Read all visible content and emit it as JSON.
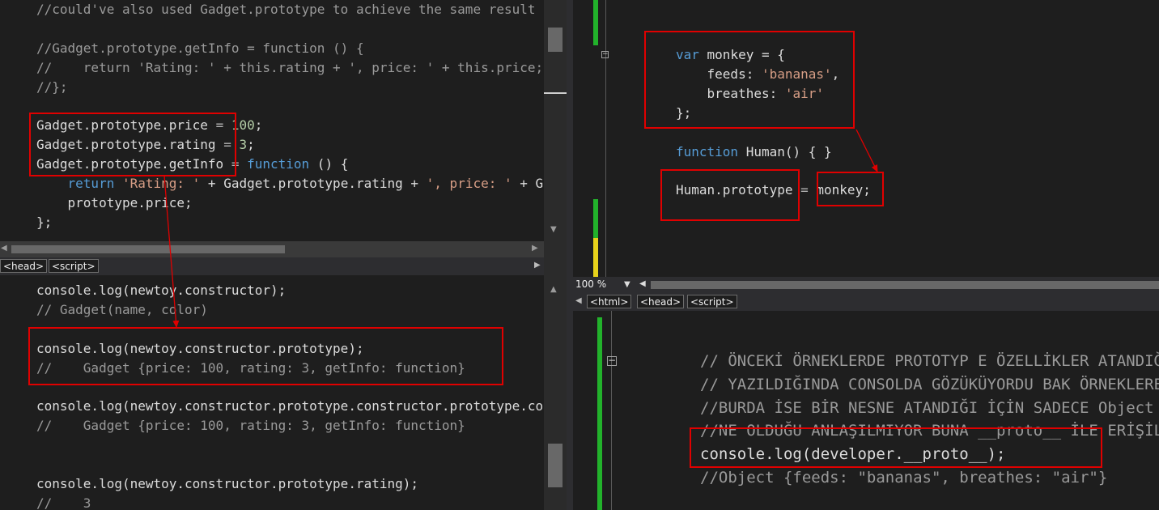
{
  "top_left": {
    "lines": [
      [
        {
          "t": "//could've also used Gadget.prototype to achieve the same result",
          "c": "cm"
        }
      ],
      [],
      [
        {
          "t": "//Gadget.prototype.getInfo = function () {",
          "c": "cm"
        }
      ],
      [
        {
          "t": "//    return 'Rating: ' + this.rating + ', price: ' + this.price;",
          "c": "cm"
        }
      ],
      [
        {
          "t": "//};",
          "c": "cm"
        }
      ],
      [],
      [
        {
          "t": "Gadget.prototype.price "
        },
        {
          "t": "=",
          "c": "op"
        },
        {
          "t": " "
        },
        {
          "t": "100",
          "c": "nm"
        },
        {
          "t": ";"
        }
      ],
      [
        {
          "t": "Gadget.prototype.rating "
        },
        {
          "t": "=",
          "c": "op"
        },
        {
          "t": " "
        },
        {
          "t": "3",
          "c": "nm"
        },
        {
          "t": ";"
        }
      ],
      [
        {
          "t": "Gadget.prototype.getInfo "
        },
        {
          "t": "=",
          "c": "op"
        },
        {
          "t": " "
        },
        {
          "t": "function",
          "c": "kw"
        },
        {
          "t": " () {"
        }
      ],
      [
        {
          "t": "    "
        },
        {
          "t": "return",
          "c": "kw"
        },
        {
          "t": " "
        },
        {
          "t": "'Rating: '",
          "c": "st"
        },
        {
          "t": " + Gadget.prototype.rating + "
        },
        {
          "t": "', price: '",
          "c": "st"
        },
        {
          "t": " + Gadget."
        }
      ],
      [
        {
          "t": "    prototype.price;"
        }
      ],
      [
        {
          "t": "};"
        }
      ]
    ],
    "breadcrumbs": [
      "<head>",
      "<script>"
    ]
  },
  "bottom_left": {
    "lines": [
      [
        {
          "t": "console.log(newtoy.constructor);"
        }
      ],
      [
        {
          "t": "// Gadget(name, color)",
          "c": "cm"
        }
      ],
      [],
      [
        {
          "t": "console.log(newtoy.constructor.prototype);"
        }
      ],
      [
        {
          "t": "//    Gadget {price: 100, rating: 3, getInfo: function}",
          "c": "cm"
        }
      ],
      [],
      [
        {
          "t": "console.log(newtoy.constructor.prototype.constructor.prototype.constructor);"
        }
      ],
      [
        {
          "t": "//    Gadget {price: 100, rating: 3, getInfo: function}",
          "c": "cm"
        }
      ],
      [],
      [],
      [
        {
          "t": "console.log(newtoy.constructor.prototype.rating);"
        }
      ],
      [
        {
          "t": "//    3",
          "c": "cm"
        }
      ]
    ]
  },
  "top_right": {
    "lines": [
      [
        {
          "t": "var",
          "c": "kw"
        },
        {
          "t": " monkey = {"
        }
      ],
      [
        {
          "t": "    feeds: "
        },
        {
          "t": "'bananas'",
          "c": "st"
        },
        {
          "t": ","
        }
      ],
      [
        {
          "t": "    breathes: "
        },
        {
          "t": "'air'",
          "c": "st"
        }
      ],
      [
        {
          "t": "};"
        }
      ],
      [],
      [
        {
          "t": "function",
          "c": "kw"
        },
        {
          "t": " Human() { }"
        }
      ],
      [],
      [
        {
          "t": "Human.prototype "
        },
        {
          "t": "=",
          "c": "op"
        },
        {
          "t": " monkey;"
        }
      ]
    ],
    "zoom": "100 %",
    "breadcrumbs": [
      "<html>",
      "<head>",
      "<script>"
    ]
  },
  "bottom_right": {
    "lines": [
      [
        {
          "t": "// ÖNCEKİ ÖRNEKLERDE PROTOTYP E ÖZELLİKLER ATANDIĞINDA",
          "c": "cm"
        }
      ],
      [
        {
          "t": "// YAZILDIĞINDA CONSOLDA GÖZÜKÜYORDU BAK ÖRNEKLERE",
          "c": "cm"
        }
      ],
      [
        {
          "t": "//BURDA İSE BİR NESNE ATANDIĞI İÇİN SADECE Object",
          "c": "cm"
        }
      ],
      [
        {
          "t": "//NE OLDUĞU ANLAŞILMIYOR BUNA __proto__ İLE ERİŞİLİYOR",
          "c": "cm"
        }
      ],
      [
        {
          "t": "console.log(developer.__proto__);"
        }
      ],
      [
        {
          "t": "//Object {feeds: \"bananas\", breathes: \"air\"}",
          "c": "cm"
        }
      ]
    ]
  }
}
